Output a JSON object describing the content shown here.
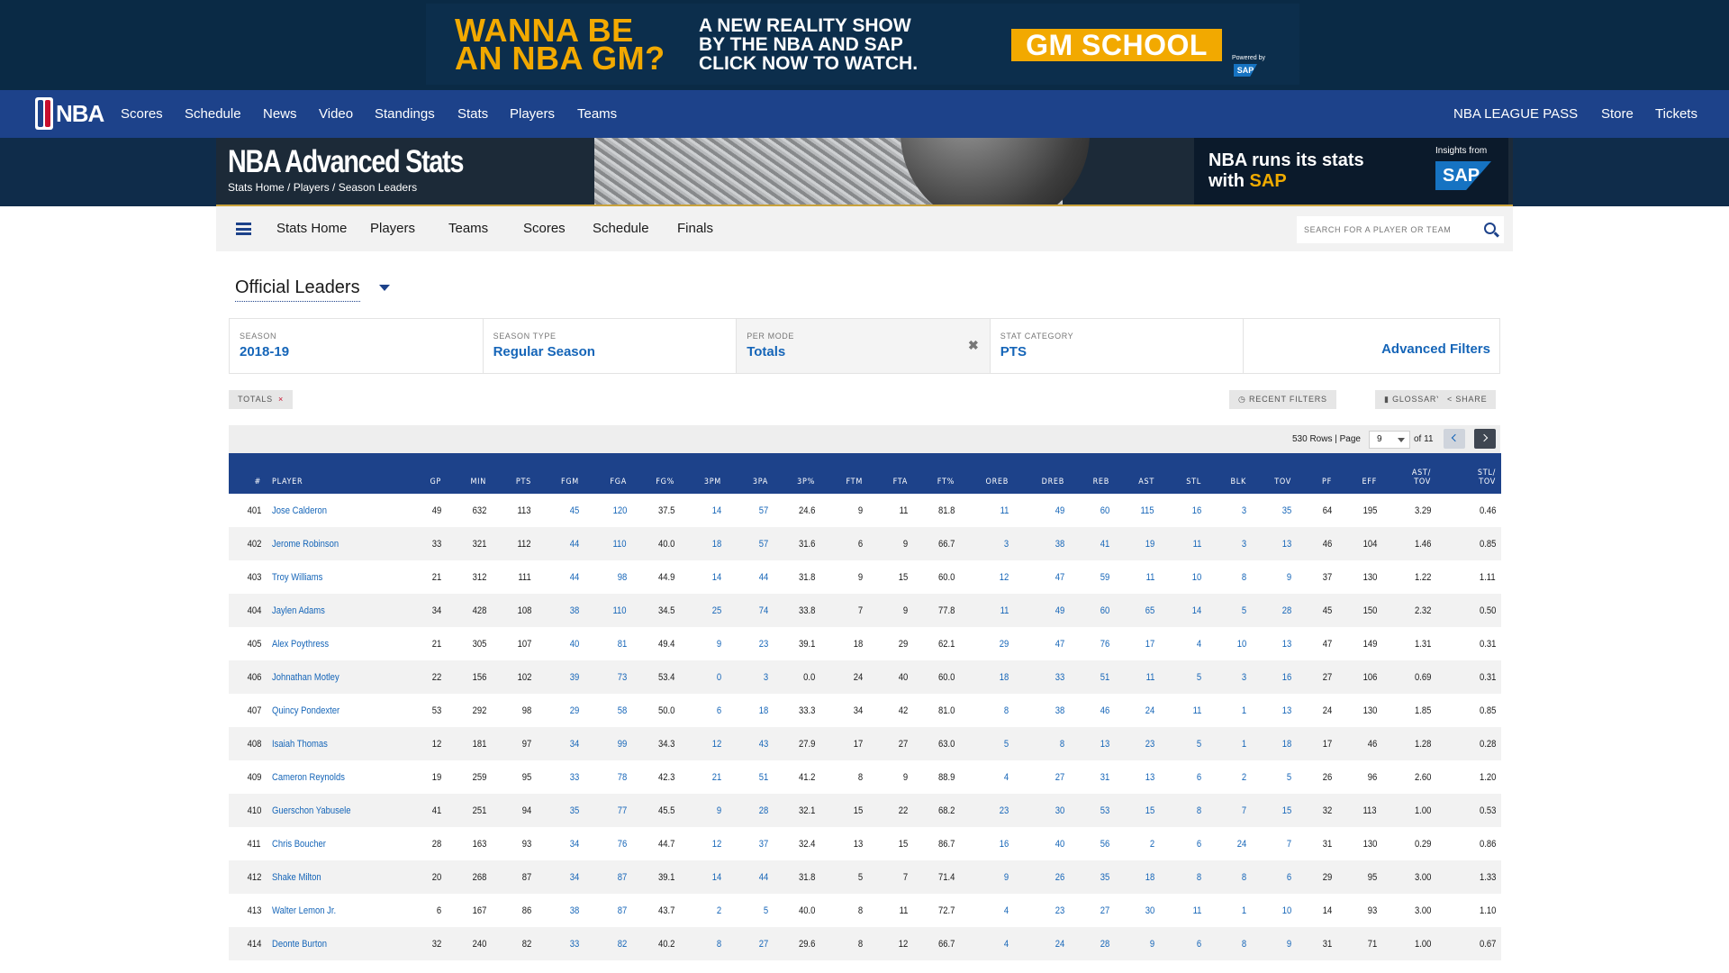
{
  "ad": {
    "left_text_line1": "WANNA BE",
    "left_text_line2": "AN NBA GM?",
    "mid_line1": "A NEW REALITY SHOW",
    "mid_line2": "BY THE NBA AND SAP",
    "mid_line3": "CLICK NOW TO WATCH.",
    "cta": "GM SCHOOL",
    "powered": "Powered by",
    "sap": "SAP"
  },
  "global_nav": {
    "logo_text": "NBA",
    "left_items": [
      "Scores",
      "Schedule",
      "News",
      "Video",
      "Standings",
      "Stats",
      "Players",
      "Teams"
    ],
    "right_items": [
      "NBA LEAGUE PASS",
      "Store",
      "Tickets"
    ]
  },
  "banner": {
    "title": "NBA Advanced Stats",
    "breadcrumb": "Stats Home / Players / Season Leaders",
    "sap_line1": "NBA runs its stats",
    "sap_line2_pre": "with ",
    "sap_line2_hl": "SAP",
    "insights": "Insights from",
    "sap_logo": "SAP"
  },
  "subnav": {
    "items": [
      "Stats Home",
      "Players",
      "Teams",
      "Scores",
      "Schedule",
      "Finals"
    ],
    "search_placeholder": "SEARCH FOR A PLAYER OR TEAM"
  },
  "leaders_select": {
    "value": "Official Leaders"
  },
  "filters": [
    {
      "label": "Season",
      "value": "2018-19"
    },
    {
      "label": "Season Type",
      "value": "Regular Season"
    },
    {
      "label": "Per Mode",
      "value": "Totals"
    },
    {
      "label": "Stat Category",
      "value": "PTS"
    }
  ],
  "advanced_filters": "Advanced Filters",
  "chips": {
    "totals": "TOTALS",
    "recent_filters": "RECENT FILTERS",
    "glossary": "GLOSSARY",
    "share": "SHARE"
  },
  "pager": {
    "rows": "530 Rows | Page",
    "page": "9",
    "of": "of 11"
  },
  "table": {
    "columns": [
      "#",
      "PLAYER",
      "GP",
      "MIN",
      "PTS",
      "FGM",
      "FGA",
      "FG%",
      "3PM",
      "3PA",
      "3P%",
      "FTM",
      "FTA",
      "FT%",
      "OREB",
      "DREB",
      "REB",
      "AST",
      "STL",
      "BLK",
      "TOV",
      "PF",
      "EFF",
      "AST/ TOV",
      "STL/ TOV"
    ],
    "rows": [
      [
        "401",
        "Jose Calderon",
        "49",
        "632",
        "113",
        "45",
        "120",
        "37.5",
        "14",
        "57",
        "24.6",
        "9",
        "11",
        "81.8",
        "11",
        "49",
        "60",
        "115",
        "16",
        "3",
        "35",
        "64",
        "195",
        "3.29",
        "0.46"
      ],
      [
        "402",
        "Jerome Robinson",
        "33",
        "321",
        "112",
        "44",
        "110",
        "40.0",
        "18",
        "57",
        "31.6",
        "6",
        "9",
        "66.7",
        "3",
        "38",
        "41",
        "19",
        "11",
        "3",
        "13",
        "46",
        "104",
        "1.46",
        "0.85"
      ],
      [
        "403",
        "Troy Williams",
        "21",
        "312",
        "111",
        "44",
        "98",
        "44.9",
        "14",
        "44",
        "31.8",
        "9",
        "15",
        "60.0",
        "12",
        "47",
        "59",
        "11",
        "10",
        "8",
        "9",
        "37",
        "130",
        "1.22",
        "1.11"
      ],
      [
        "404",
        "Jaylen Adams",
        "34",
        "428",
        "108",
        "38",
        "110",
        "34.5",
        "25",
        "74",
        "33.8",
        "7",
        "9",
        "77.8",
        "11",
        "49",
        "60",
        "65",
        "14",
        "5",
        "28",
        "45",
        "150",
        "2.32",
        "0.50"
      ],
      [
        "405",
        "Alex Poythress",
        "21",
        "305",
        "107",
        "40",
        "81",
        "49.4",
        "9",
        "23",
        "39.1",
        "18",
        "29",
        "62.1",
        "29",
        "47",
        "76",
        "17",
        "4",
        "10",
        "13",
        "47",
        "149",
        "1.31",
        "0.31"
      ],
      [
        "406",
        "Johnathan Motley",
        "22",
        "156",
        "102",
        "39",
        "73",
        "53.4",
        "0",
        "3",
        "0.0",
        "24",
        "40",
        "60.0",
        "18",
        "33",
        "51",
        "11",
        "5",
        "3",
        "16",
        "27",
        "106",
        "0.69",
        "0.31"
      ],
      [
        "407",
        "Quincy Pondexter",
        "53",
        "292",
        "98",
        "29",
        "58",
        "50.0",
        "6",
        "18",
        "33.3",
        "34",
        "42",
        "81.0",
        "8",
        "38",
        "46",
        "24",
        "11",
        "1",
        "13",
        "24",
        "130",
        "1.85",
        "0.85"
      ],
      [
        "408",
        "Isaiah Thomas",
        "12",
        "181",
        "97",
        "34",
        "99",
        "34.3",
        "12",
        "43",
        "27.9",
        "17",
        "27",
        "63.0",
        "5",
        "8",
        "13",
        "23",
        "5",
        "1",
        "18",
        "17",
        "46",
        "1.28",
        "0.28"
      ],
      [
        "409",
        "Cameron Reynolds",
        "19",
        "259",
        "95",
        "33",
        "78",
        "42.3",
        "21",
        "51",
        "41.2",
        "8",
        "9",
        "88.9",
        "4",
        "27",
        "31",
        "13",
        "6",
        "2",
        "5",
        "26",
        "96",
        "2.60",
        "1.20"
      ],
      [
        "410",
        "Guerschon Yabusele",
        "41",
        "251",
        "94",
        "35",
        "77",
        "45.5",
        "9",
        "28",
        "32.1",
        "15",
        "22",
        "68.2",
        "23",
        "30",
        "53",
        "15",
        "8",
        "7",
        "15",
        "32",
        "113",
        "1.00",
        "0.53"
      ],
      [
        "411",
        "Chris Boucher",
        "28",
        "163",
        "93",
        "34",
        "76",
        "44.7",
        "12",
        "37",
        "32.4",
        "13",
        "15",
        "86.7",
        "16",
        "40",
        "56",
        "2",
        "6",
        "24",
        "7",
        "31",
        "130",
        "0.29",
        "0.86"
      ],
      [
        "412",
        "Shake Milton",
        "20",
        "268",
        "87",
        "34",
        "87",
        "39.1",
        "14",
        "44",
        "31.8",
        "5",
        "7",
        "71.4",
        "9",
        "26",
        "35",
        "18",
        "8",
        "8",
        "6",
        "29",
        "95",
        "3.00",
        "1.33"
      ],
      [
        "413",
        "Walter Lemon Jr.",
        "6",
        "167",
        "86",
        "38",
        "87",
        "43.7",
        "2",
        "5",
        "40.0",
        "8",
        "11",
        "72.7",
        "4",
        "23",
        "27",
        "30",
        "11",
        "1",
        "10",
        "14",
        "93",
        "3.00",
        "1.10"
      ],
      [
        "414",
        "Deonte Burton",
        "32",
        "240",
        "82",
        "33",
        "82",
        "40.2",
        "8",
        "27",
        "29.6",
        "8",
        "12",
        "66.7",
        "4",
        "24",
        "28",
        "9",
        "6",
        "8",
        "9",
        "31",
        "71",
        "1.00",
        "0.67"
      ]
    ],
    "link_columns": [
      1,
      5,
      6,
      8,
      9,
      14,
      15,
      16,
      17,
      18,
      19,
      20
    ]
  }
}
